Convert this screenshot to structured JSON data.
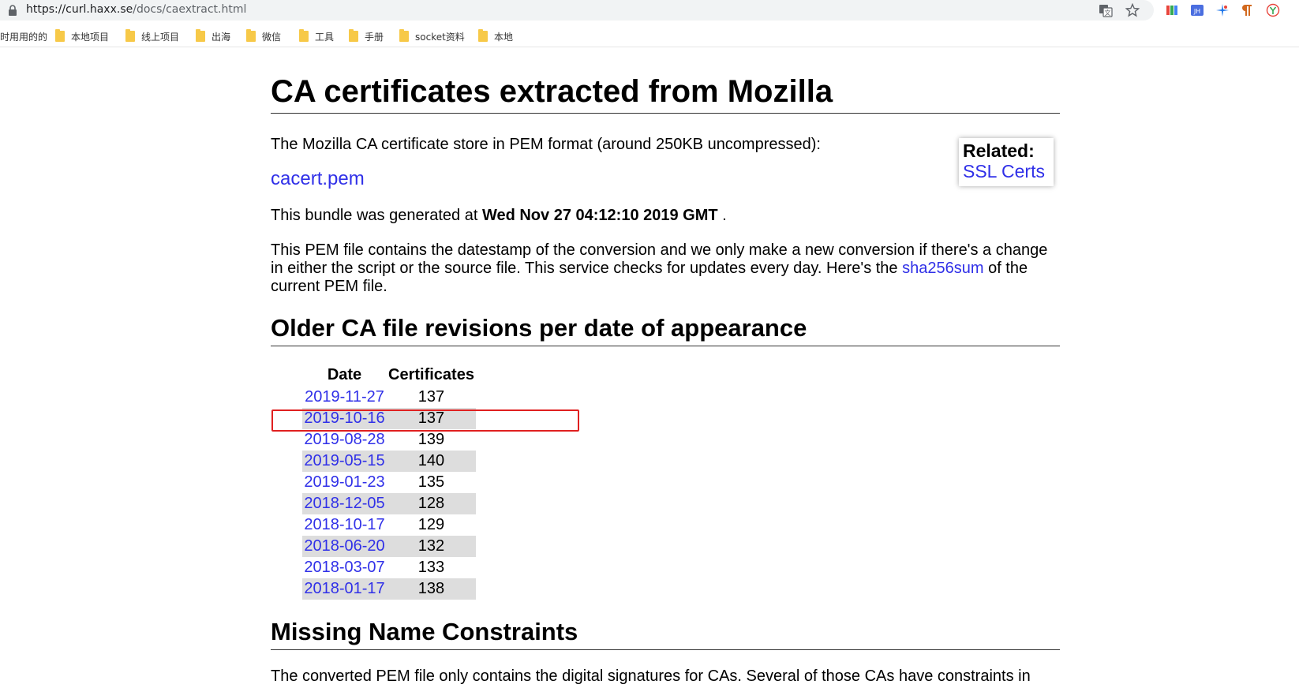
{
  "browser": {
    "url_host": "https://curl.haxx.se",
    "url_path": "/docs/caextract.html",
    "bookmarks": [
      "时用用的的",
      "本地项目",
      "线上项目",
      "出海",
      "微信",
      "工具",
      "手册",
      "socket资料",
      "本地"
    ]
  },
  "page": {
    "title": "CA certificates extracted from Mozilla",
    "intro": "The Mozilla CA certificate store in PEM format (around 250KB uncompressed):",
    "pem_link": "cacert.pem",
    "generated_prefix": "This bundle was generated at ",
    "generated_date": "Wed Nov 27 04:12:10 2019 GMT",
    "generated_suffix": " .",
    "pem_text_1": "This PEM file contains the datestamp of the conversion and we only make a new conversion if there's a change in either the script or the source file. This service checks for updates every day. Here's the ",
    "sha_link": "sha256sum",
    "pem_text_2": " of the current PEM file.",
    "related_title": "Related:",
    "related_link": "SSL Certs",
    "older_heading": "Older CA file revisions per date of appearance",
    "table_headers": {
      "date": "Date",
      "certificates": "Certificates"
    },
    "revisions": [
      {
        "date": "2019-11-27",
        "count": "137"
      },
      {
        "date": "2019-10-16",
        "count": "137"
      },
      {
        "date": "2019-08-28",
        "count": "139"
      },
      {
        "date": "2019-05-15",
        "count": "140"
      },
      {
        "date": "2019-01-23",
        "count": "135"
      },
      {
        "date": "2018-12-05",
        "count": "128"
      },
      {
        "date": "2018-10-17",
        "count": "129"
      },
      {
        "date": "2018-06-20",
        "count": "132"
      },
      {
        "date": "2018-03-07",
        "count": "133"
      },
      {
        "date": "2018-01-17",
        "count": "138"
      }
    ],
    "missing_heading": "Missing Name Constraints",
    "missing_text": "The converted PEM file only contains the digital signatures for CAs. Several of those CAs have constraints in"
  },
  "colors": {
    "link": "#3030e8",
    "row_shade": "#dddddd",
    "highlight": "#e02020"
  },
  "icons": [
    "lock-icon",
    "translate-icon",
    "star-icon",
    "folder-icon"
  ]
}
